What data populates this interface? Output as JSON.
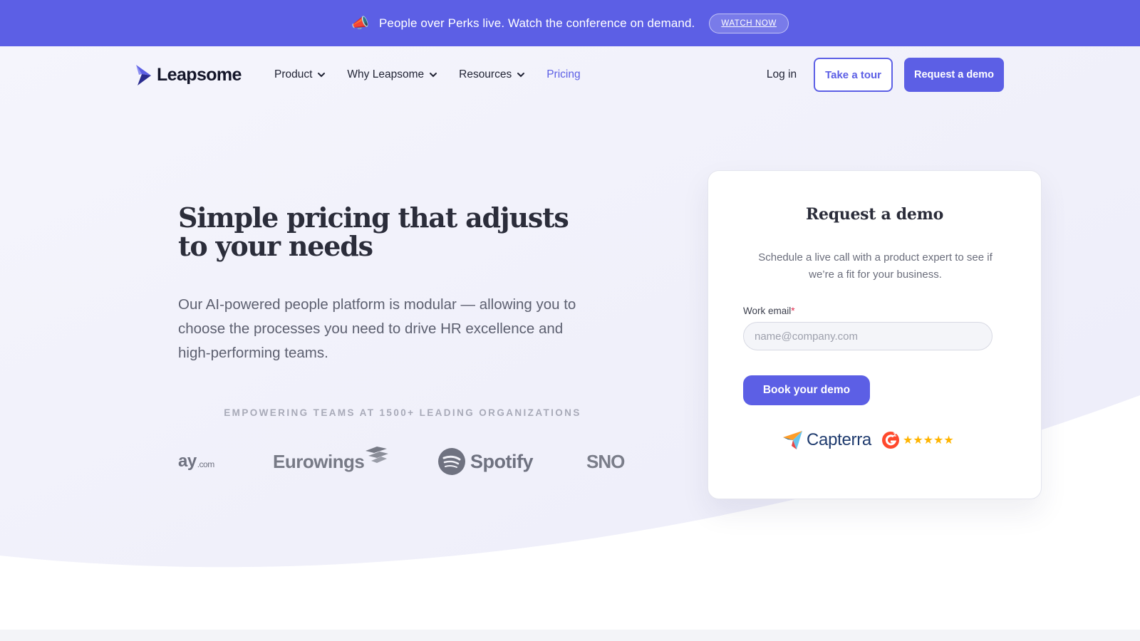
{
  "announcement": {
    "icon": "megaphone-icon",
    "emoji": "📣",
    "text": "People over Perks live. Watch the conference on demand.",
    "cta": "WATCH NOW"
  },
  "nav": {
    "brand": "Leapsome",
    "links": [
      {
        "label": "Product",
        "has_dropdown": true
      },
      {
        "label": "Why Leapsome",
        "has_dropdown": true
      },
      {
        "label": "Resources",
        "has_dropdown": true
      },
      {
        "label": "Pricing",
        "has_dropdown": false
      }
    ],
    "login": "Log in",
    "tour": "Take a tour",
    "demo": "Request a demo"
  },
  "hero": {
    "title": "Simple pricing that adjusts to your needs",
    "subtitle": "Our AI-powered people platform is modular — allowing you to choose the processes you need to drive HR excellence and high-performing teams.",
    "trusted": "EMPOWERING TEAMS AT 1500+ LEADING ORGANIZATIONS",
    "logos": {
      "ay": "ay",
      "ay_suffix": ".com",
      "eurowings": "Eurowings",
      "spotify": "Spotify",
      "sno": "SNO"
    }
  },
  "demo_form": {
    "title": "Request a demo",
    "description": "Schedule a live call with a product expert to see if we’re a fit for your business.",
    "email_label": "Work email",
    "required_mark": "*",
    "email_placeholder": "name@company.com",
    "email_value": "",
    "submit": "Book your demo",
    "review_brand": "Capterra",
    "rating_stars": "★★★★★"
  },
  "colors": {
    "brand": "#5c5fe5",
    "heading": "#2b2d3a",
    "star": "#ffb400"
  }
}
